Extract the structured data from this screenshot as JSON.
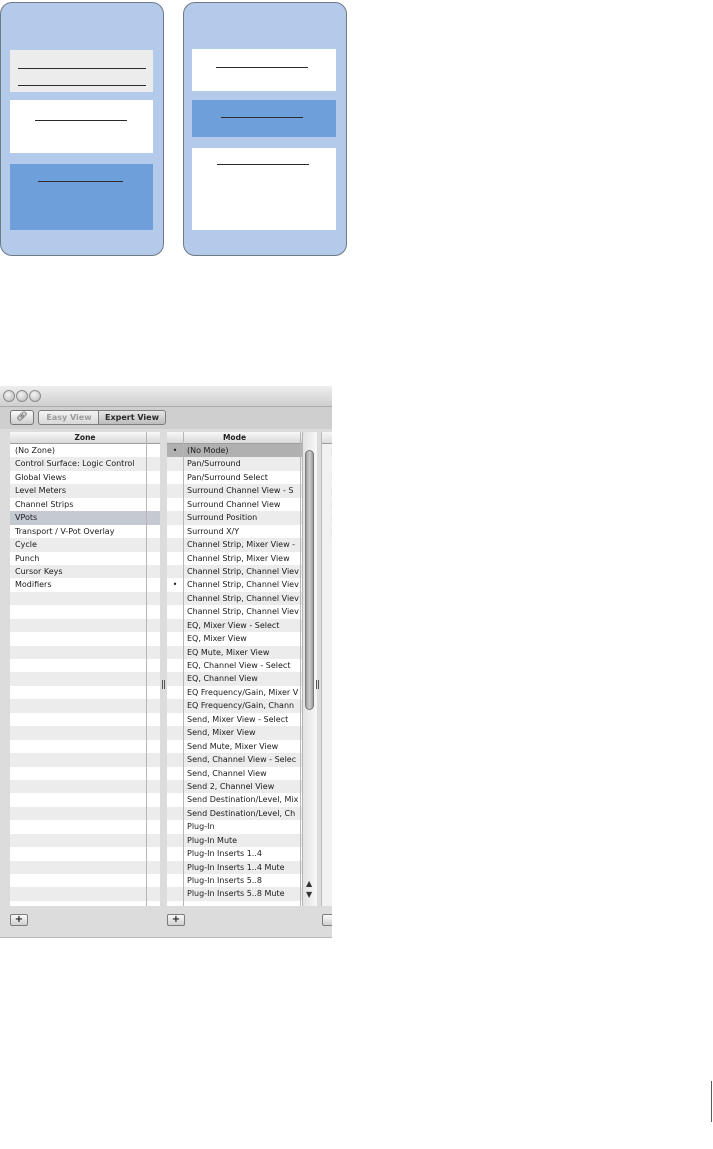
{
  "window": {
    "toolbar": {
      "link_icon": "chain-link-icon",
      "easy_view_label": "Easy View",
      "expert_view_label": "Expert View",
      "active_view": "Expert View"
    },
    "zone_column": {
      "header": "Zone",
      "selected": "VPots",
      "items": [
        "(No Zone)",
        "Control Surface: Logic Control",
        "Global Views",
        "Level Meters",
        "Channel Strips",
        "VPots",
        "Transport / V-Pot Overlay",
        "Cycle",
        "Punch",
        "Cursor Keys",
        "Modifiers"
      ]
    },
    "mode_column": {
      "header": "Mode",
      "selected": "(No Mode)",
      "bullet_rows": [
        "(No Mode)",
        "Channel Strip, Channel View"
      ],
      "items": [
        "(No Mode)",
        "Pan/Surround",
        "Pan/Surround Select",
        "Surround Channel View - S",
        "Surround Channel View",
        "Surround Position",
        "Surround X/Y",
        "Channel Strip, Mixer View -",
        "Channel Strip, Mixer View",
        "Channel Strip, Channel Viev",
        "Channel Strip, Channel Viev",
        "Channel Strip, Channel Viev",
        "Channel Strip, Channel Viev",
        "EQ, Mixer View - Select",
        "EQ, Mixer View",
        "EQ Mute, Mixer View",
        "EQ, Channel View - Select",
        "EQ, Channel View",
        "EQ Frequency/Gain, Mixer V",
        "EQ Frequency/Gain, Chann",
        "Send, Mixer View - Select",
        "Send, Mixer View",
        "Send Mute, Mixer View",
        "Send, Channel View - Selec",
        "Send, Channel View",
        "Send 2, Channel View",
        "Send Destination/Level, Mix",
        "Send Destination/Level, Ch",
        "Plug-In",
        "Plug-In Mute",
        "Plug-In Inserts 1..4",
        "Plug-In Inserts 1..4 Mute",
        "Plug-In Inserts 5..8",
        "Plug-In Inserts 5..8 Mute"
      ]
    },
    "bullet_glyph": "•",
    "add_zone_label": "+",
    "add_mode_label": "+",
    "scroll_up_glyph": "▲",
    "scroll_down_glyph": "▼",
    "splitter_icon": "column-splitter-icon"
  },
  "colors": {
    "card_fill": "#b3caea",
    "highlight_blue": "#6e9fdb"
  }
}
